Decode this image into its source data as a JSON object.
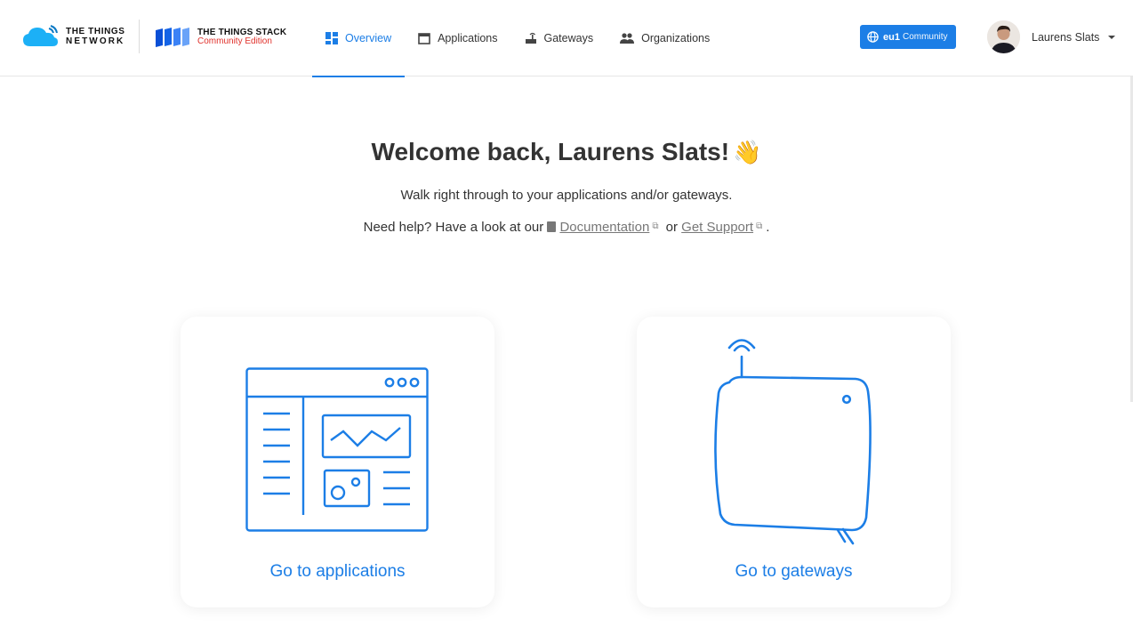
{
  "header": {
    "brand_ttn_line1": "THE THINGS",
    "brand_ttn_line2": "NETWORK",
    "brand_tts_line1": "THE THINGS STACK",
    "brand_tts_line2": "Community Edition",
    "nav": [
      {
        "label": "Overview",
        "icon": "dashboard-icon",
        "active": true
      },
      {
        "label": "Applications",
        "icon": "window-icon",
        "active": false
      },
      {
        "label": "Gateways",
        "icon": "router-icon",
        "active": false
      },
      {
        "label": "Organizations",
        "icon": "people-icon",
        "active": false
      }
    ],
    "cluster": {
      "region": "eu1",
      "label": "Community",
      "icon": "globe-icon"
    },
    "user": {
      "name": "Laurens Slats"
    }
  },
  "main": {
    "welcome_text": "Welcome back, Laurens Slats!",
    "welcome_emoji": "👋",
    "subtitle": "Walk right through to your applications and/or gateways.",
    "help_prefix": "Need help? Have a look at our",
    "documentation_link": "Documentation",
    "help_or": "or",
    "support_link": "Get Support",
    "help_suffix": ".",
    "cards": [
      {
        "label": "Go to applications",
        "icon": "application-illustration"
      },
      {
        "label": "Go to gateways",
        "icon": "gateway-illustration"
      }
    ]
  },
  "colors": {
    "accent": "#1c7ee6",
    "brand_red": "#e0312b",
    "text": "#333333"
  }
}
